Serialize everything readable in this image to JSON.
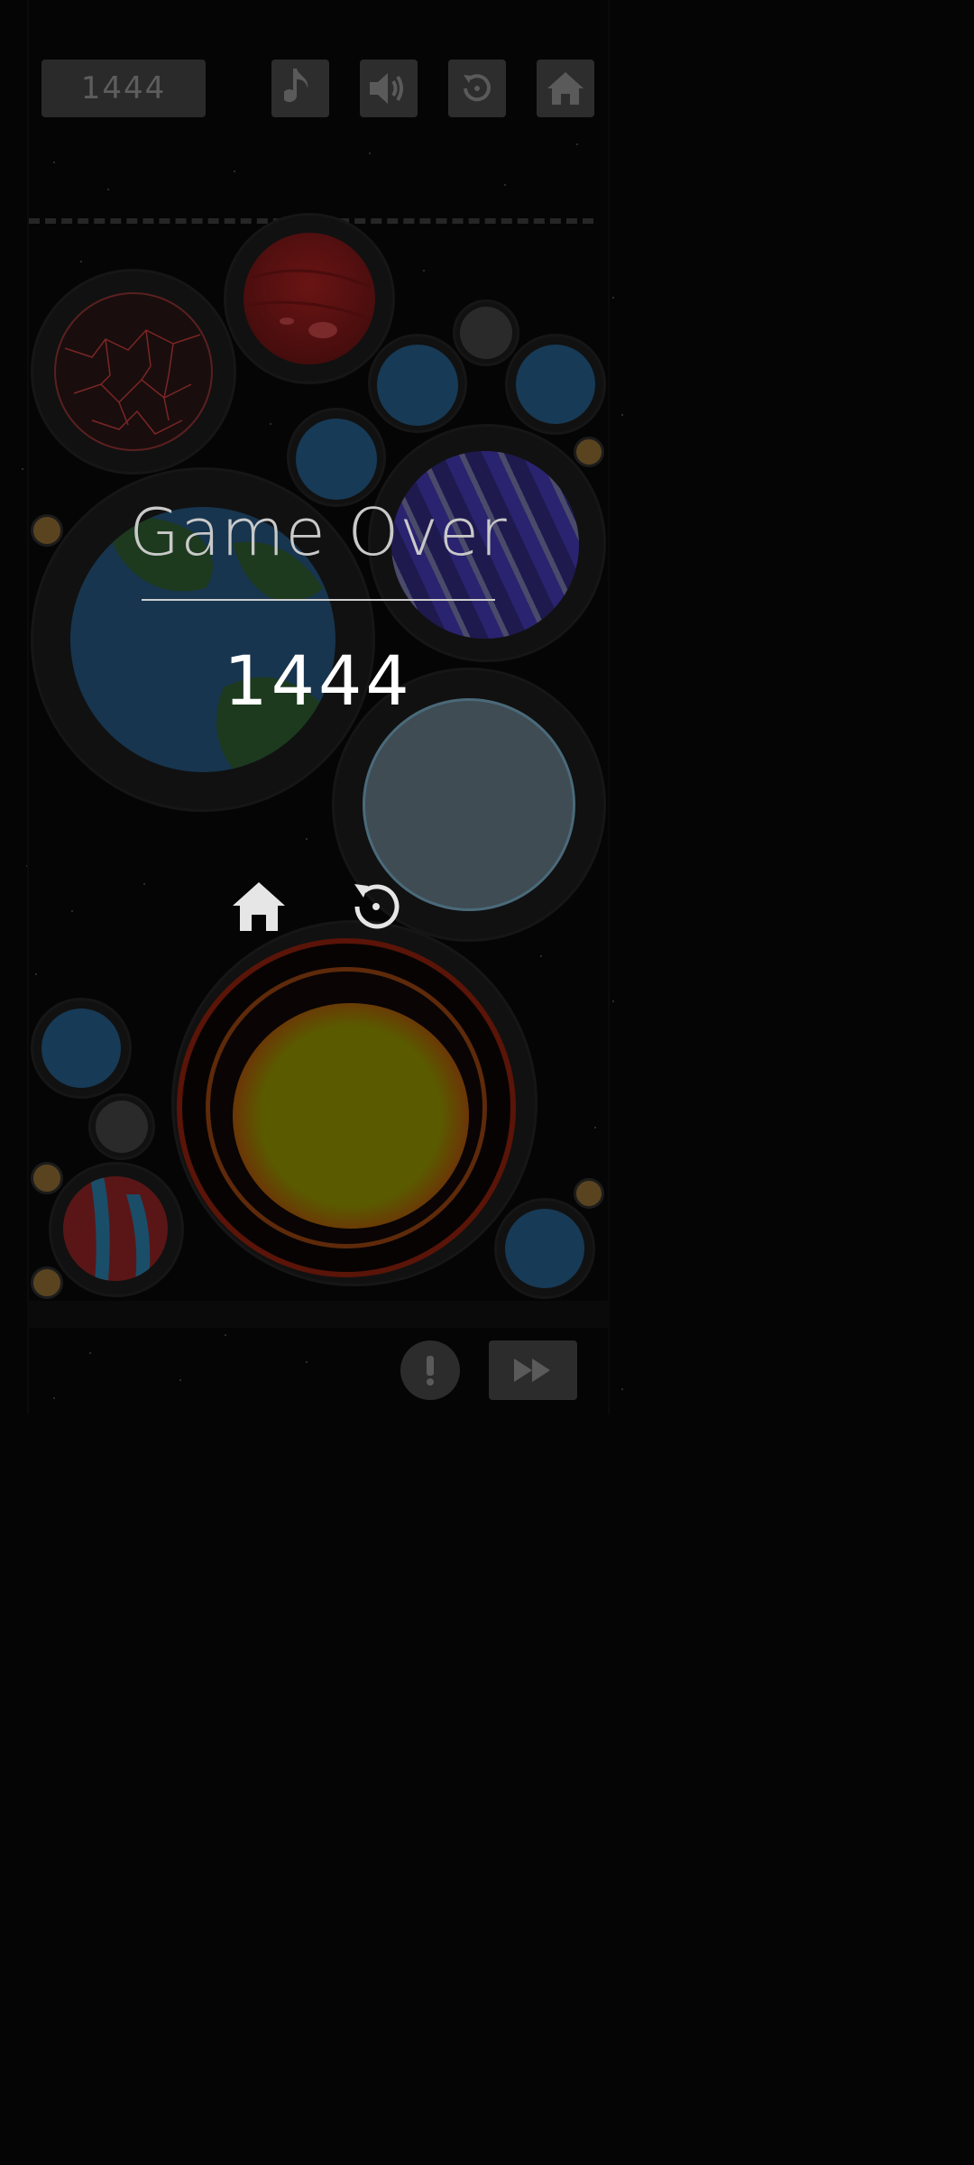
{
  "hud": {
    "score": "1444",
    "buttons": [
      "music-icon",
      "sound-icon",
      "restart-icon",
      "home-icon"
    ]
  },
  "game_over": {
    "title": "Game Over",
    "final_score": "1444",
    "buttons": [
      "home-icon",
      "restart-icon"
    ]
  },
  "footer": {
    "buttons": [
      "alert-icon",
      "fast-forward-icon"
    ]
  },
  "colors": {
    "background": "#050505",
    "button_bg": "#2d2d2d",
    "icon_gray": "#5a5a5a",
    "overlay_text": "#c9c9c9",
    "score_text": "#ffffff"
  }
}
